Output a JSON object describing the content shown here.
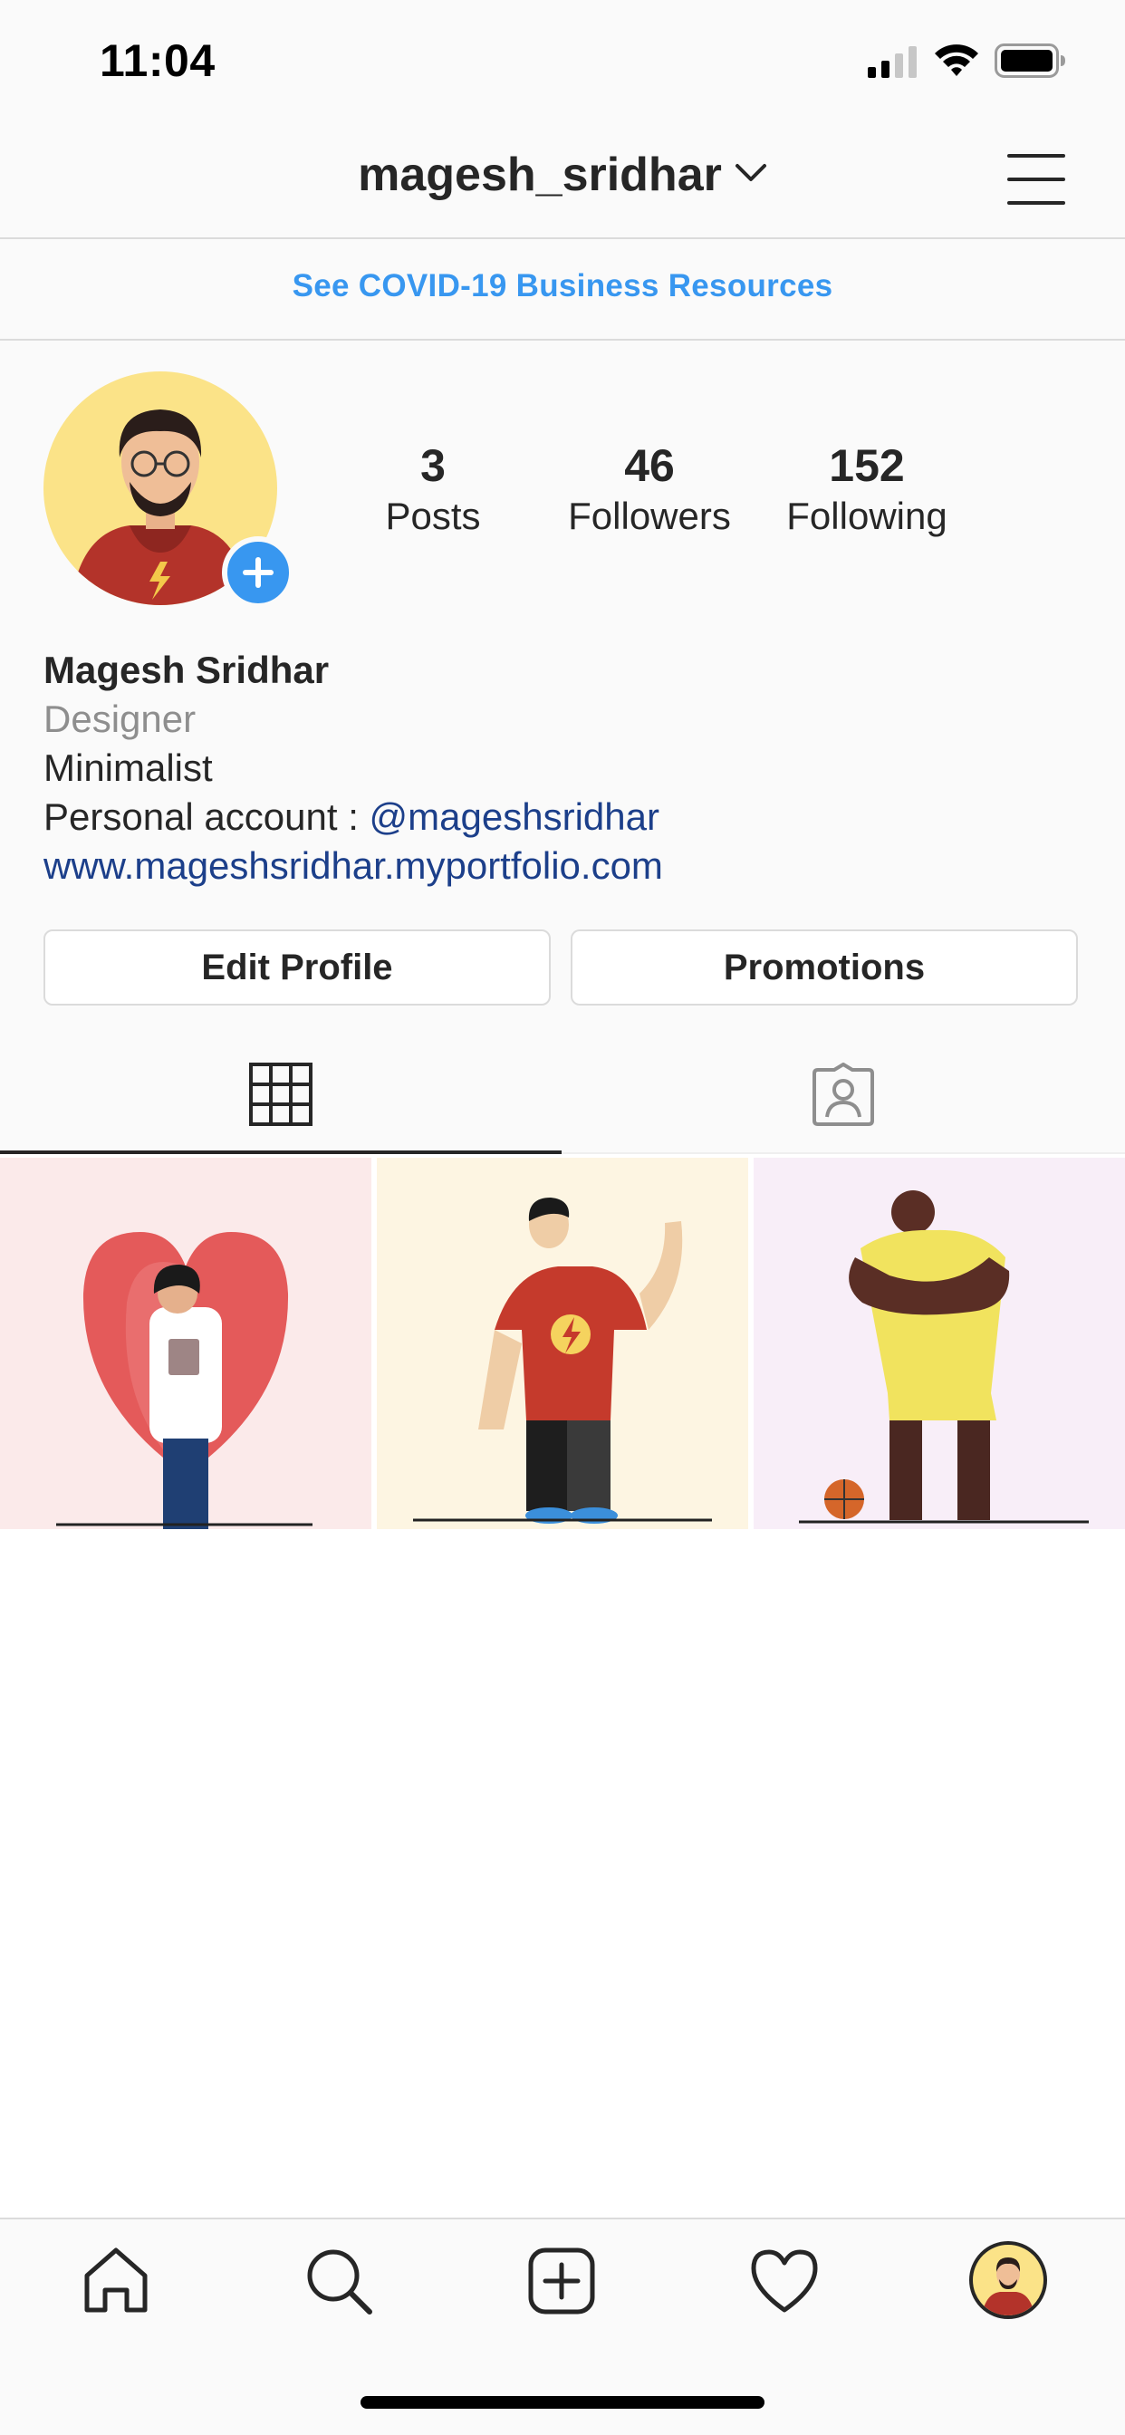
{
  "status_bar": {
    "time": "11:04",
    "signal_icon": "cellular-signal-icon",
    "wifi_icon": "wifi-icon",
    "battery_icon": "battery-icon"
  },
  "header": {
    "username": "magesh_sridhar",
    "switch_icon": "chevron-down-icon",
    "menu_icon": "hamburger-menu-icon"
  },
  "banner": {
    "link_text": "See COVID-19 Business Resources",
    "color": "#3897f0"
  },
  "profile": {
    "stats": [
      {
        "value": "3",
        "label": "Posts"
      },
      {
        "value": "46",
        "label": "Followers"
      },
      {
        "value": "152",
        "label": "Following"
      }
    ],
    "full_name": "Magesh Sridhar",
    "category": "Designer",
    "bio": "Minimalist",
    "personal_prefix": "Personal account : ",
    "personal_handle": "@mageshsridhar",
    "website": "www.mageshsridhar.myportfolio.com",
    "add_story_icon": "plus-icon"
  },
  "buttons": {
    "edit_profile": "Edit Profile",
    "promotions": "Promotions"
  },
  "tabs": [
    {
      "name": "grid",
      "icon": "grid-icon",
      "active": true
    },
    {
      "name": "tagged",
      "icon": "tagged-person-icon",
      "active": false
    }
  ],
  "posts": [
    {
      "subject": "doctor-heart-illustration",
      "bg": "#fbeaea"
    },
    {
      "subject": "flash-shirt-man-waving-illustration",
      "bg": "#fdf5e2"
    },
    {
      "subject": "basketball-player-illustration",
      "bg": "#f8eef8"
    }
  ],
  "bottom_nav": [
    "home-icon",
    "search-icon",
    "add-post-icon",
    "heart-icon",
    "profile-avatar"
  ],
  "colors": {
    "link": "#1c3f8a",
    "accent": "#3897f0",
    "divider": "#dbdbdb",
    "secondary_text": "#8e8e8e"
  }
}
